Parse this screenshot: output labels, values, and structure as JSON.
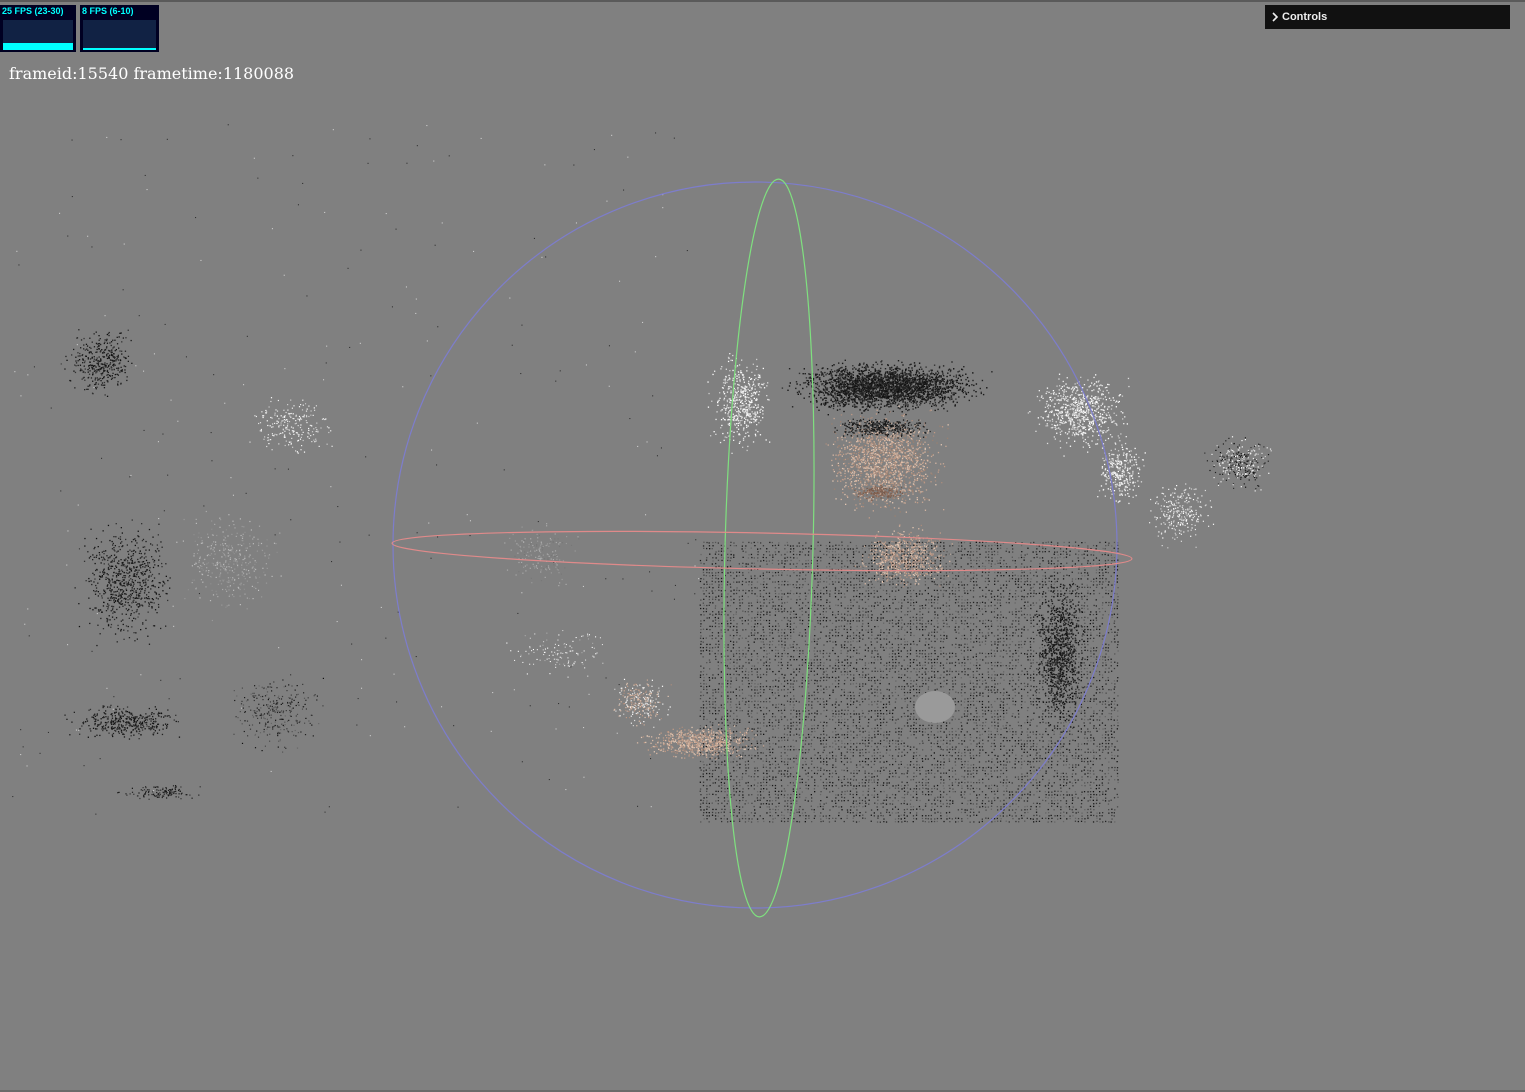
{
  "stats": {
    "fps_label": "25 FPS (23-30)",
    "fps_level": 0.22,
    "ms_label": "8 FPS (6-10)",
    "ms_level": 0.08
  },
  "frame_info": "frameid:15540 frametime:1180088",
  "controls": {
    "title": "Controls",
    "icon": "chevron-right-icon"
  },
  "colors": {
    "background": "#808080",
    "stats_text": "#00ffff",
    "stats_bg": "#000022",
    "ring_x": "#e08a8a",
    "ring_y": "#7fe07f",
    "ring_z": "#7d7dcc"
  }
}
